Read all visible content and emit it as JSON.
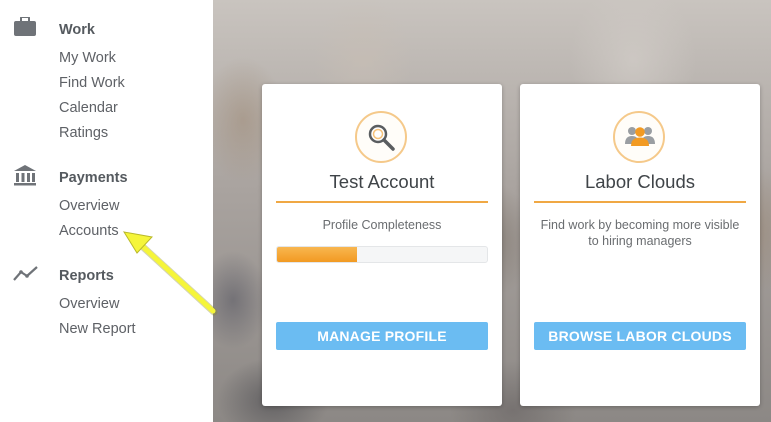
{
  "sidebar": {
    "sections": [
      {
        "title": "Work",
        "icon": "briefcase-icon",
        "items": [
          "My Work",
          "Find Work",
          "Calendar",
          "Ratings"
        ]
      },
      {
        "title": "Payments",
        "icon": "bank-icon",
        "items": [
          "Overview",
          "Accounts"
        ]
      },
      {
        "title": "Reports",
        "icon": "line-chart-icon",
        "items": [
          "Overview",
          "New Report"
        ]
      }
    ]
  },
  "cards": [
    {
      "title": "Test Account",
      "icon": "magnifier-icon",
      "text": "Profile Completeness",
      "progress": 0.38,
      "button": "MANAGE PROFILE"
    },
    {
      "title": "Labor Clouds",
      "icon": "group-icon",
      "text": "Find work by becoming more visible to hiring managers",
      "button": "BROWSE LABOR CLOUDS"
    }
  ],
  "colors": {
    "accent": "#f0a844",
    "button": "#6bbcf2",
    "annotation_arrow": "#f5f53a"
  }
}
